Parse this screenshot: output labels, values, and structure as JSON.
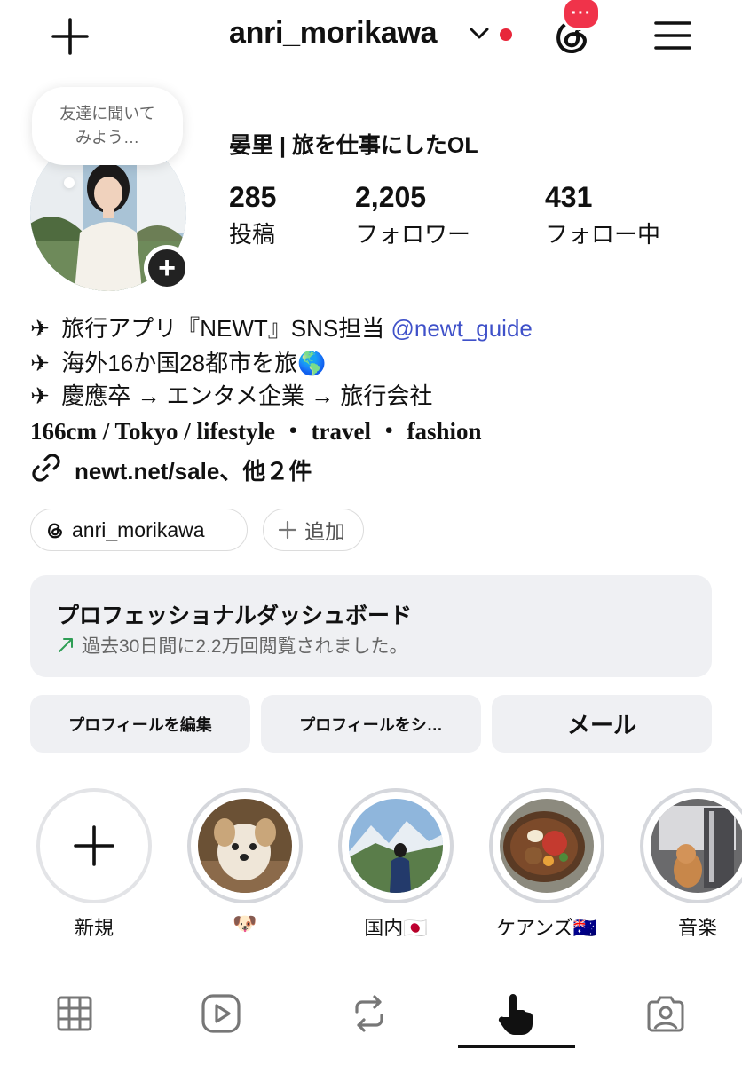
{
  "header": {
    "username": "anri_morikawa",
    "threads_badge": "···"
  },
  "profile": {
    "note": "友達に聞いて\nみよう…",
    "display_name": "晏里 | 旅を仕事にしたOL",
    "stats": [
      {
        "value": "285",
        "label": "投稿"
      },
      {
        "value": "2,205",
        "label": "フォロワー"
      },
      {
        "value": "431",
        "label": "フォロー中"
      }
    ]
  },
  "bio": {
    "plane": "✈",
    "line1_text": "旅行アプリ『NEWT』SNS担当",
    "line1_mention": "@newt_guide",
    "line2": "海外16か国28都市を旅🌎",
    "line3": "慶應卒 → エンタメ企業 → 旅行会社",
    "line4": "166cm / Tokyo / lifestyle ・ travel ・ fashion",
    "link": "newt.net/sale、他２件"
  },
  "pills": {
    "threads": "anri_morikawa",
    "add": "追加"
  },
  "dashboard": {
    "title": "プロフェッショナルダッシュボード",
    "subtitle": "過去30日間に2.2万回閲覧されました。"
  },
  "actions": {
    "edit": "プロフィールを編集",
    "share": "プロフィールをシ…",
    "mail": "メール"
  },
  "highlights": [
    {
      "label": "新規"
    },
    {
      "label": "🐶"
    },
    {
      "label": "国内🇯🇵"
    },
    {
      "label": "ケアンズ🇦🇺"
    },
    {
      "label": "音楽"
    }
  ],
  "colors": {
    "accent_red": "#f0334a",
    "mention": "#3f51c9",
    "card_bg": "#eff0f3"
  }
}
